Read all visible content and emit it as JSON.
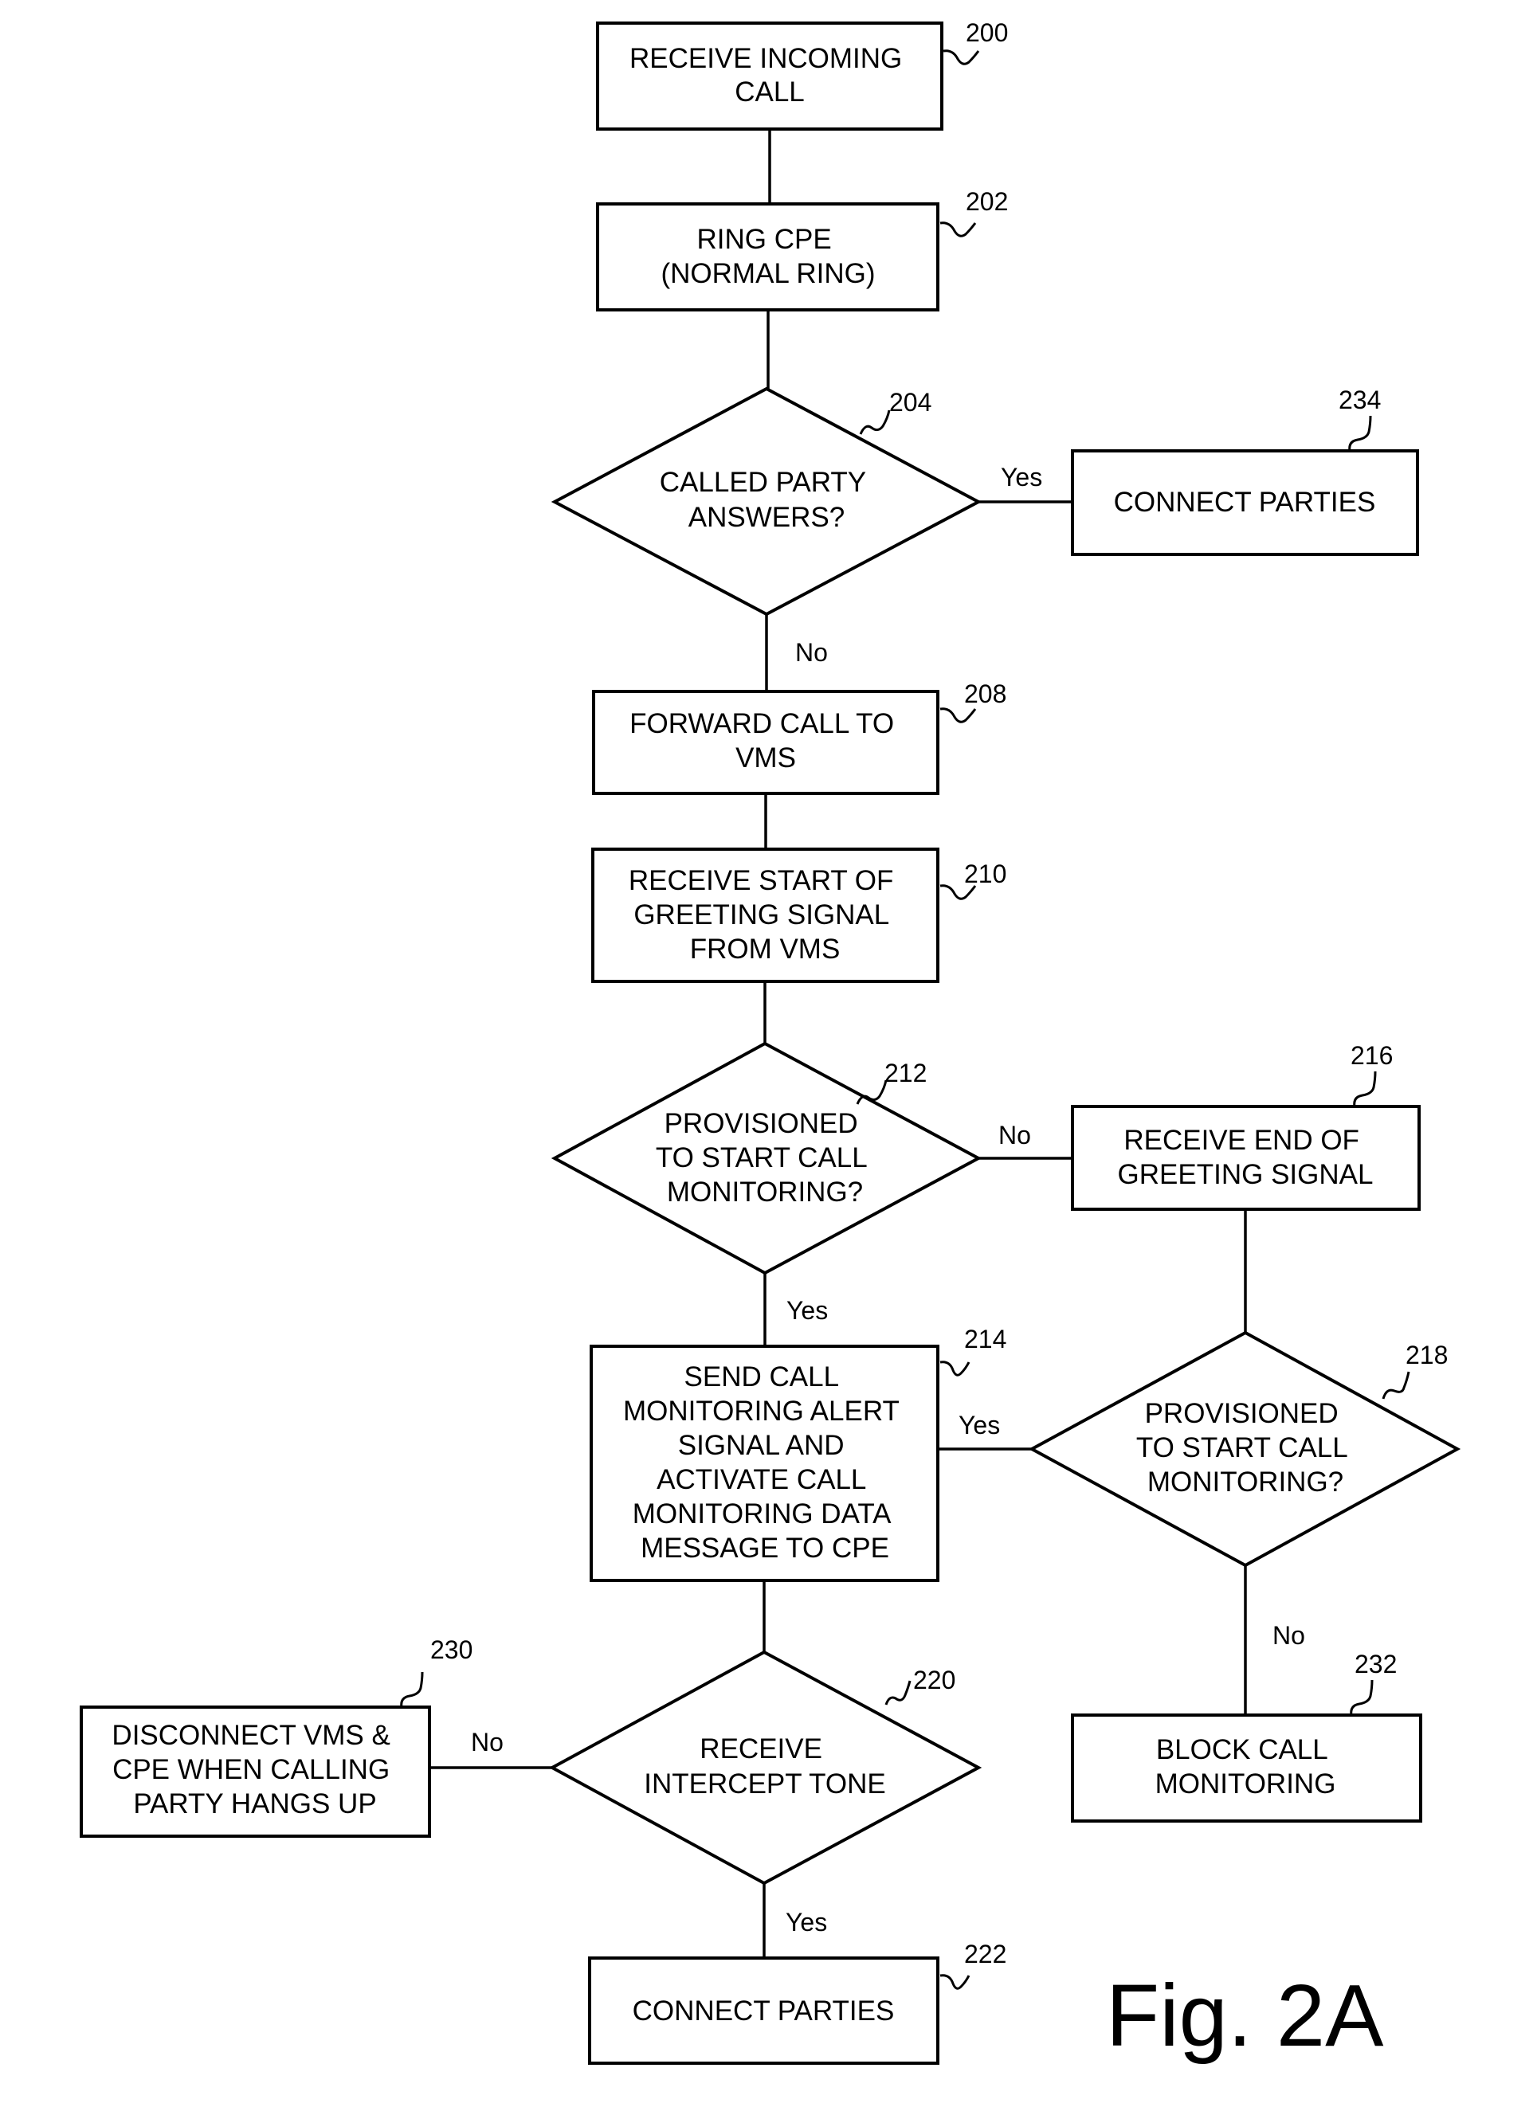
{
  "figure": {
    "title": "Fig. 2A"
  },
  "nodes": {
    "n200": {
      "ref": "200",
      "type": "process",
      "lines": [
        "RECEIVE INCOMING",
        "CALL"
      ]
    },
    "n202": {
      "ref": "202",
      "type": "process",
      "lines": [
        "RING CPE",
        "(NORMAL RING)"
      ]
    },
    "n204": {
      "ref": "204",
      "type": "decision",
      "lines": [
        "CALLED PARTY",
        "ANSWERS?"
      ]
    },
    "n234": {
      "ref": "234",
      "type": "process",
      "lines": [
        "CONNECT PARTIES"
      ]
    },
    "n208": {
      "ref": "208",
      "type": "process",
      "lines": [
        "FORWARD CALL TO",
        "VMS"
      ]
    },
    "n210": {
      "ref": "210",
      "type": "process",
      "lines": [
        "RECEIVE START OF",
        "GREETING SIGNAL",
        "FROM VMS"
      ]
    },
    "n212": {
      "ref": "212",
      "type": "decision",
      "lines": [
        "PROVISIONED",
        "TO START CALL",
        "MONITORING?"
      ]
    },
    "n216": {
      "ref": "216",
      "type": "process",
      "lines": [
        "RECEIVE END OF",
        "GREETING SIGNAL"
      ]
    },
    "n214": {
      "ref": "214",
      "type": "process",
      "lines": [
        "SEND CALL",
        "MONITORING ALERT",
        "SIGNAL AND",
        "ACTIVATE CALL",
        "MONITORING DATA",
        "MESSAGE TO CPE"
      ]
    },
    "n218": {
      "ref": "218",
      "type": "decision",
      "lines": [
        "PROVISIONED",
        "TO START CALL",
        "MONITORING?"
      ]
    },
    "n220": {
      "ref": "220",
      "type": "decision",
      "lines": [
        "RECEIVE",
        "INTERCEPT TONE"
      ]
    },
    "n230": {
      "ref": "230",
      "type": "process",
      "lines": [
        "DISCONNECT VMS &",
        "CPE WHEN CALLING",
        "PARTY HANGS UP"
      ]
    },
    "n232": {
      "ref": "232",
      "type": "process",
      "lines": [
        "BLOCK CALL",
        "MONITORING"
      ]
    },
    "n222": {
      "ref": "222",
      "type": "process",
      "lines": [
        "CONNECT PARTIES"
      ]
    }
  },
  "edges": [
    {
      "from": "200",
      "to": "202",
      "label": ""
    },
    {
      "from": "202",
      "to": "204",
      "label": ""
    },
    {
      "from": "204",
      "to": "234",
      "label": "Yes"
    },
    {
      "from": "204",
      "to": "208",
      "label": "No"
    },
    {
      "from": "208",
      "to": "210",
      "label": ""
    },
    {
      "from": "210",
      "to": "212",
      "label": ""
    },
    {
      "from": "212",
      "to": "216",
      "label": "No"
    },
    {
      "from": "212",
      "to": "214",
      "label": "Yes"
    },
    {
      "from": "216",
      "to": "218",
      "label": ""
    },
    {
      "from": "218",
      "to": "214",
      "label": "Yes"
    },
    {
      "from": "218",
      "to": "232",
      "label": "No"
    },
    {
      "from": "214",
      "to": "220",
      "label": ""
    },
    {
      "from": "220",
      "to": "230",
      "label": "No"
    },
    {
      "from": "220",
      "to": "222",
      "label": "Yes"
    }
  ],
  "edge_labels": {
    "e204_yes": "Yes",
    "e204_no": "No",
    "e212_no": "No",
    "e212_yes": "Yes",
    "e218_yes": "Yes",
    "e218_no": "No",
    "e220_no": "No",
    "e220_yes": "Yes"
  }
}
